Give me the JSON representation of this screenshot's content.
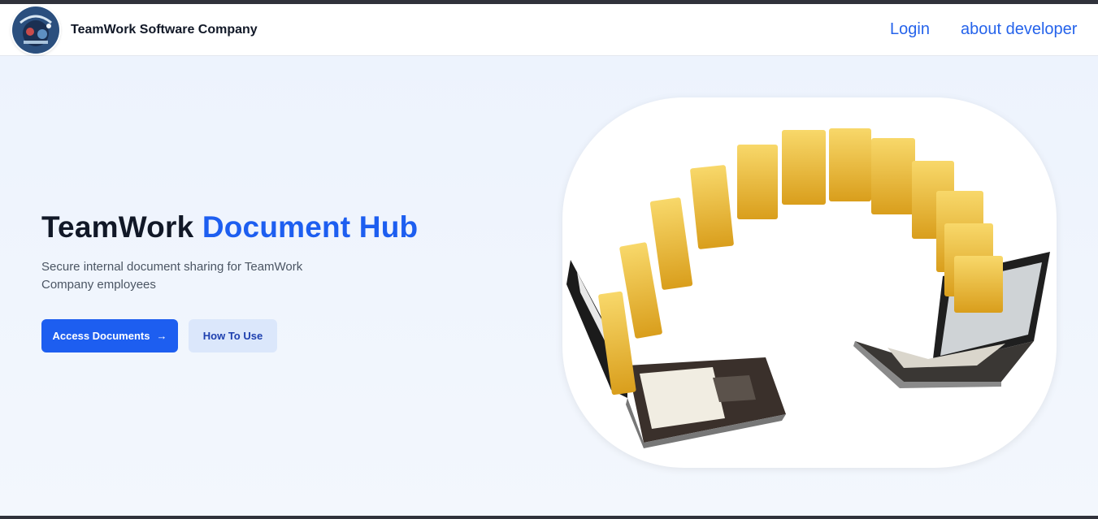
{
  "brand": {
    "name": "TeamWork Software Company",
    "logo_icon": "company-logo-icon"
  },
  "nav": {
    "login": "Login",
    "about": "about developer"
  },
  "hero": {
    "title_part1": "TeamWork ",
    "title_accent": "Document Hub",
    "subtitle": "Secure internal document sharing for TeamWork Company employees",
    "primary_button": "Access Documents",
    "primary_button_icon": "arrow-right-icon",
    "secondary_button": "How To Use",
    "image_icon": "laptops-file-transfer-illustration"
  },
  "colors": {
    "accent": "#1d5ef0",
    "link": "#2563eb",
    "heading": "#111827",
    "background": "#eef4fd",
    "folder": "#f2c23c"
  }
}
